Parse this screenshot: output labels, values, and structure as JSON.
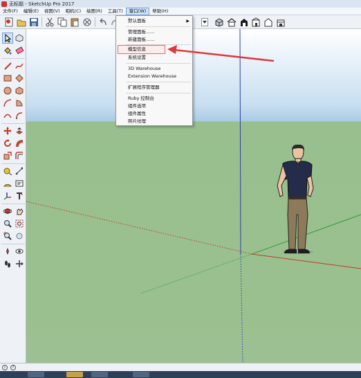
{
  "window": {
    "title": "无标题 - SketchUp Pro 2017"
  },
  "menubar": {
    "items": [
      {
        "label": "文件(F)"
      },
      {
        "label": "编辑(E)"
      },
      {
        "label": "视图(V)"
      },
      {
        "label": "相机(C)"
      },
      {
        "label": "绘图(R)"
      },
      {
        "label": "工具(T)"
      },
      {
        "label": "窗口(W)"
      },
      {
        "label": "帮助(H)"
      }
    ],
    "active_index": 6
  },
  "window_menu": {
    "items": [
      {
        "label": "默认面板",
        "submenu": true
      },
      {
        "label": "管理面板......"
      },
      {
        "label": "新建面板......"
      },
      {
        "label": "模型信息",
        "highlighted": true
      },
      {
        "label": "系统设置"
      },
      {
        "label": "3D Warehouse"
      },
      {
        "label": "Extension Warehouse"
      },
      {
        "label": "扩展程序管理器"
      },
      {
        "label": "Ruby 控制台"
      },
      {
        "label": "组件选项"
      },
      {
        "label": "组件属性"
      },
      {
        "label": "照片纹理"
      }
    ]
  },
  "toolbar": {
    "icons": [
      "new-file-icon",
      "open-icon",
      "save-icon",
      "cut-icon",
      "copy-icon",
      "paste-icon",
      "erase-icon",
      "undo-icon",
      "redo-icon",
      "iso-view-icon",
      "top-view-icon",
      "front-view-icon",
      "right-view-icon",
      "back-view-icon",
      "left-view-icon"
    ]
  },
  "palette": {
    "icons": [
      "select-icon",
      "component-icon",
      "paint-bucket-icon",
      "eraser-icon",
      "line-icon",
      "freehand-icon",
      "rectangle-icon",
      "rotated-rectangle-icon",
      "circle-icon",
      "polygon-icon",
      "arc-icon",
      "pie-icon",
      "two-point-arc-icon",
      "three-point-arc-icon",
      "move-icon",
      "push-pull-icon",
      "rotate-icon",
      "follow-me-icon",
      "scale-icon",
      "offset-icon",
      "tape-measure-icon",
      "dimension-icon",
      "protractor-icon",
      "text-icon",
      "axes-icon",
      "3d-text-icon",
      "orbit-icon",
      "pan-icon",
      "zoom-icon",
      "zoom-window-icon",
      "zoom-extents-icon",
      "previous-icon",
      "position-camera-icon",
      "look-around-icon",
      "walk-icon",
      "section-plane-icon"
    ]
  },
  "colors": {
    "sky": "#a9cbe6",
    "ground": "#9cc091",
    "axis_red": "#c0392b",
    "axis_green": "#2e9c38",
    "axis_blue": "#2c3fa8",
    "annotation_arrow": "#e0393b"
  },
  "status": {
    "icons": [
      "info-icon",
      "help-icon"
    ]
  }
}
